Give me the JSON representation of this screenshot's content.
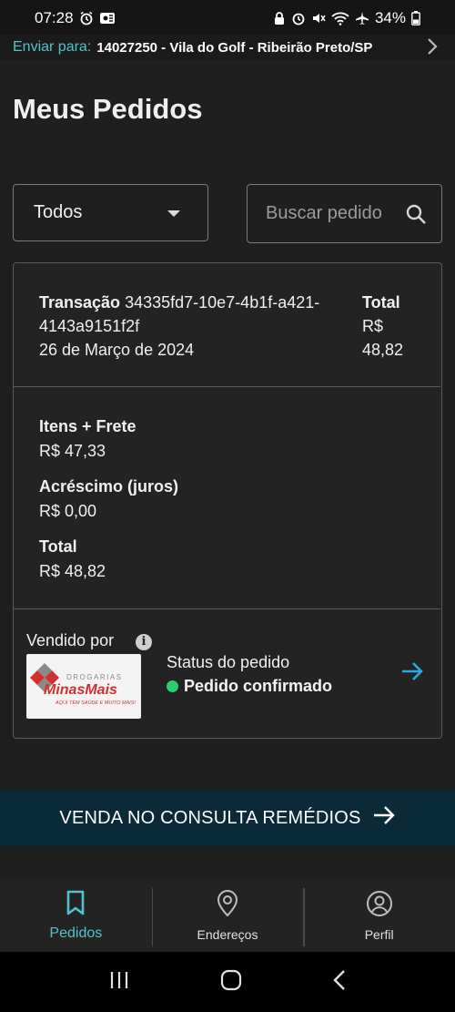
{
  "status_bar": {
    "time": "07:28",
    "battery": "34%"
  },
  "shipping": {
    "label": "Enviar para:",
    "address": "14027250 - Vila do Golf - Ribeirão Preto/SP"
  },
  "page": {
    "title": "Meus Pedidos"
  },
  "filter": {
    "selected": "Todos"
  },
  "search": {
    "placeholder": "Buscar pedido"
  },
  "order": {
    "transaction_label": "Transação",
    "transaction_id": "34335fd7-10e7-4b1f-a421-4143a9151f2f",
    "date": "26 de Março de 2024",
    "total_label": "Total",
    "total_value": "R$ 48,82",
    "items_label": "Itens + Frete",
    "items_value": "R$ 47,33",
    "surcharge_label": "Acréscimo (juros)",
    "surcharge_value": "R$ 0,00",
    "grand_total_label": "Total",
    "grand_total_value": "R$ 48,82",
    "sold_by_label": "Vendido por",
    "seller_name": "MinasMais",
    "seller_prefix": "DROGARIAS",
    "seller_tagline": "AQUI TEM SAÚDE E MUITO MAIS!",
    "status_label": "Status do pedido",
    "status_value": "Pedido confirmado",
    "status_color": "#2ecc71"
  },
  "promo": {
    "label": "VENDA NO CONSULTA REMÉDIOS"
  },
  "nav": {
    "items": [
      {
        "label": "Pedidos",
        "icon": "bookmark-icon",
        "active": true
      },
      {
        "label": "Endereços",
        "icon": "location-pin-icon",
        "active": false
      },
      {
        "label": "Perfil",
        "icon": "user-circle-icon",
        "active": false
      }
    ]
  },
  "colors": {
    "accent": "#4fc3c9",
    "banner": "#0a2a3a",
    "background": "#1f1f1f",
    "arrow": "#29a9e0"
  }
}
